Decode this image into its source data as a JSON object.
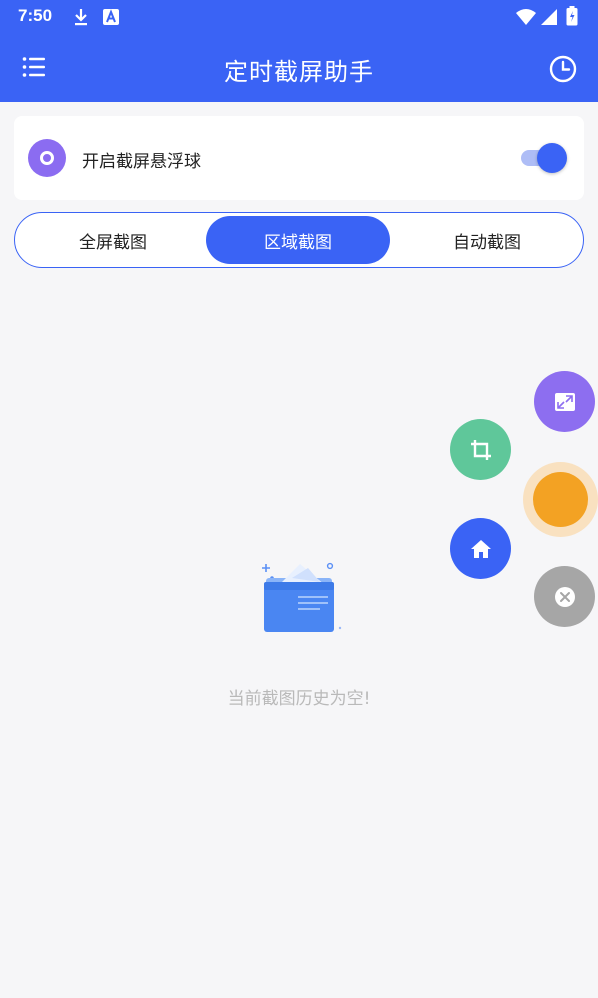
{
  "status_bar": {
    "time": "7:50",
    "icons": [
      "download-icon",
      "a-notification-icon",
      "wifi-icon",
      "signal-icon",
      "battery-icon"
    ]
  },
  "app_bar": {
    "title": "定时截屏助手",
    "left_icon": "menu-icon",
    "right_icon": "history-clock-icon"
  },
  "floating_ball_card": {
    "label": "开启截屏悬浮球",
    "toggle_on": true
  },
  "tabs": {
    "items": [
      "全屏截图",
      "区域截图",
      "自动截图"
    ],
    "selected_index": 1
  },
  "empty_state": {
    "icon": "empty-folder-icon",
    "message": "当前截图历史为空!"
  },
  "floating_menu": {
    "buttons": [
      "expand-icon",
      "crop-icon",
      "center-ball",
      "home-icon",
      "close-icon"
    ]
  },
  "colors": {
    "primary": "#3a63f5",
    "purple": "#8d6ef0",
    "green": "#5fc79a",
    "orange": "#f3a223",
    "gray": "#a6a6a6",
    "background": "#f6f6f8"
  }
}
